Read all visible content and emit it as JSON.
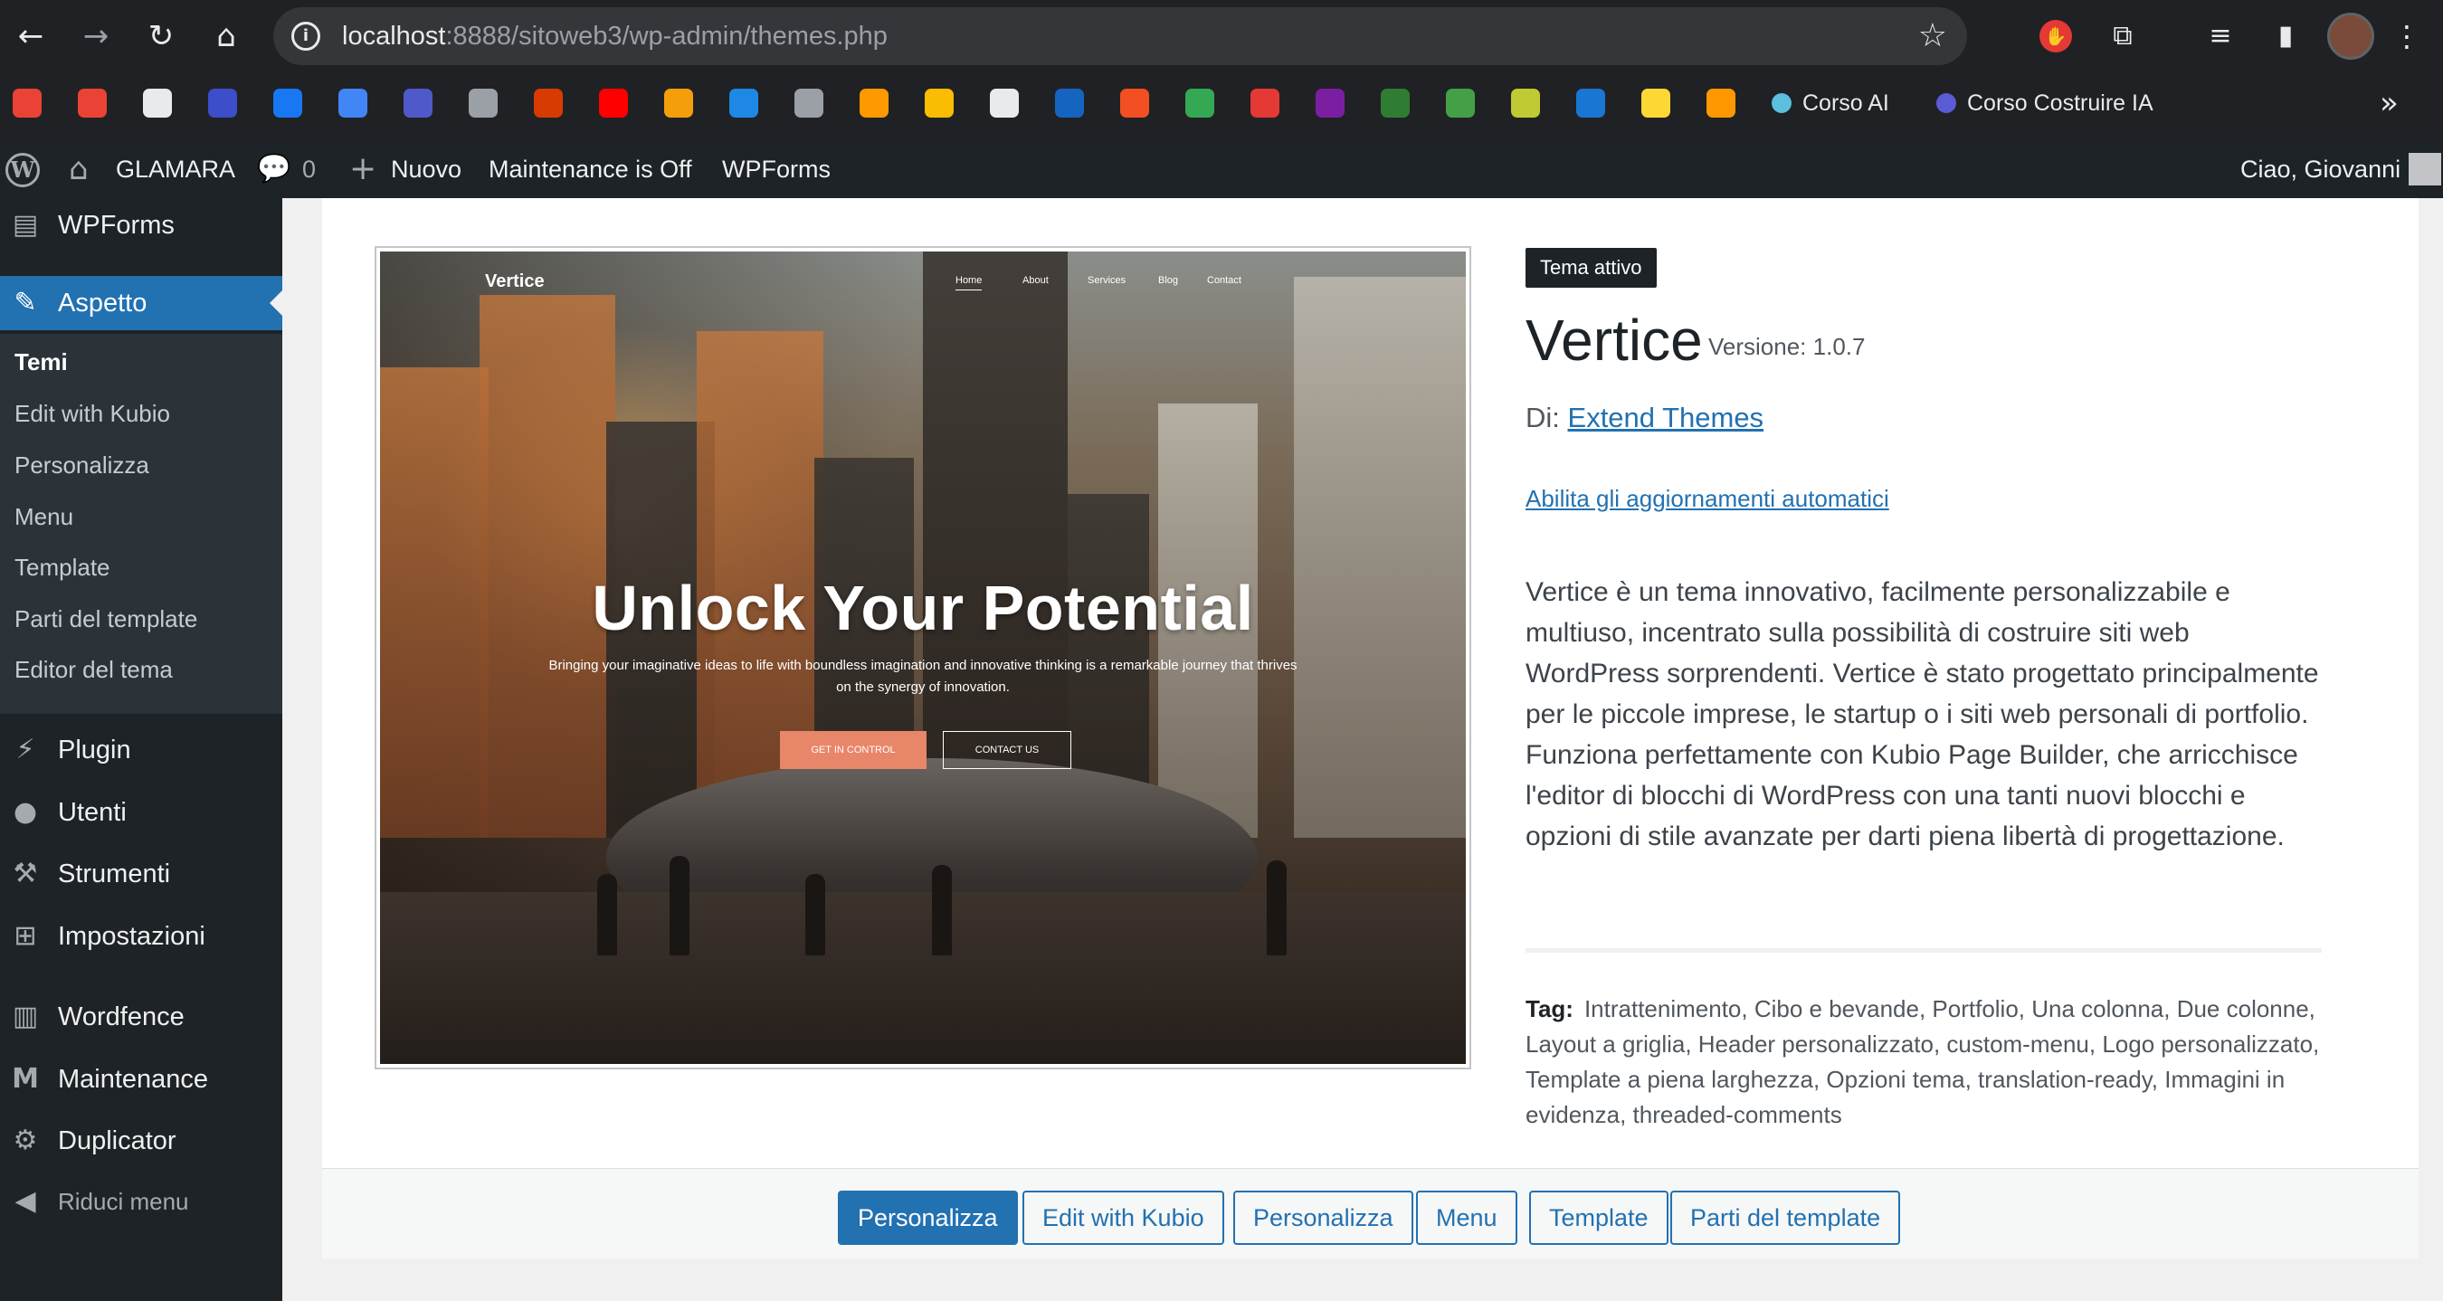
{
  "browser": {
    "url_host": "localhost",
    "url_path": ":8888/sitoweb3/wp-admin/themes.php",
    "bookmarks": [
      {
        "label": "Corso AI",
        "color": "#5bc0de"
      },
      {
        "label": "Corso Costruire IA",
        "color": "#5b5bd6"
      }
    ],
    "bookmark_icon_colors": [
      "#ea4335",
      "#ea4335",
      "#e8eaed",
      "#3c4ec9",
      "#1877f2",
      "#4285f4",
      "#5059c9",
      "#9aa0a6",
      "#d83b01",
      "#ff0000",
      "#f59e0b",
      "#1e88e5",
      "#9aa0a6",
      "#ff9900",
      "#fbbc04",
      "#e8eaed",
      "#1565c0",
      "#f25022",
      "#34a853",
      "#e53935",
      "#7b1fa2",
      "#2e7d32",
      "#43a047",
      "#c0ca33",
      "#1976d2",
      "#fdd835",
      "#ff9800"
    ]
  },
  "adminbar": {
    "site_name": "GLAMARA",
    "comments_count": "0",
    "new_label": "Nuovo",
    "maintenance_label": "Maintenance is Off",
    "wpforms_label": "WPForms",
    "greeting": "Ciao, Giovanni"
  },
  "sidebar": {
    "wpforms": "WPForms",
    "appearance": "Aspetto",
    "submenu": [
      "Temi",
      "Edit with Kubio",
      "Personalizza",
      "Menu",
      "Template",
      "Parti del template",
      "Editor del tema"
    ],
    "plugins": "Plugin",
    "users": "Utenti",
    "tools": "Strumenti",
    "settings": "Impostazioni",
    "wordfence": "Wordfence",
    "maintenance": "Maintenance",
    "duplicator": "Duplicator",
    "collapse": "Riduci menu"
  },
  "preview": {
    "brand": "Vertice",
    "nav": [
      "Home",
      "About",
      "Services",
      "Blog",
      "Contact"
    ],
    "hero_title": "Unlock Your Potential",
    "hero_sub": "Bringing your imaginative ideas to life with boundless imagination and innovative thinking is a remarkable journey that thrives on the synergy of innovation.",
    "btn_primary": "GET IN CONTROL",
    "btn_secondary": "CONTACT US"
  },
  "theme": {
    "badge": "Tema attivo",
    "name": "Vertice",
    "version": "Versione: 1.0.7",
    "author_prefix": "Di:",
    "author": "Extend Themes",
    "auto_update": "Abilita gli aggiornamenti automatici",
    "description": "Vertice è un tema innovativo, facilmente personalizzabile e multiuso, incentrato sulla possibilità di costruire siti web WordPress sorprendenti. Vertice è stato progettato principalmente per le piccole imprese, le startup o i siti web personali di portfolio. Funziona perfettamente con Kubio Page Builder, che arricchisce l'editor di blocchi di WordPress con una tanti nuovi blocchi e opzioni di stile avanzate per darti piena libertà di progettazione.",
    "tags_label": "Tag:",
    "tags": "Intrattenimento, Cibo e bevande, Portfolio, Una colonna, Due colonne, Layout a griglia, Header personalizzato, custom-menu, Logo personalizzato, Template a piena larghezza, Opzioni tema, translation-ready, Immagini in evidenza, threaded-comments"
  },
  "actions": {
    "customize_primary": "Personalizza",
    "edit_kubio": "Edit with Kubio",
    "customize": "Personalizza",
    "menu": "Menu",
    "template": "Template",
    "template_parts": "Parti del template"
  },
  "colors": {
    "admin_dark": "#1d2327",
    "accent_blue": "#2271b1",
    "browser_dark": "#202124"
  }
}
